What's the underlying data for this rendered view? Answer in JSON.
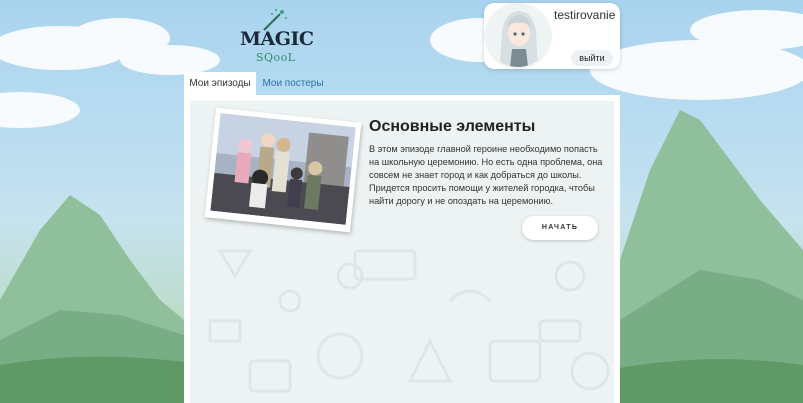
{
  "logo": {
    "line1": "MAGIC",
    "line2": "SQooL"
  },
  "profile": {
    "username": "testirovanie",
    "logout_label": "выйти"
  },
  "tabs": [
    {
      "label": "Мои эпизоды",
      "active": true
    },
    {
      "label": "Мои постеры",
      "active": false
    }
  ],
  "episode": {
    "title": "Основные элементы",
    "description": "В этом эпизоде главной героине необходимо попасть на школьную церемонию. Но есть одна проблема, она совсем не знает город и как добраться до школы. Придется просить помощи у жителей городка, чтобы найти дорогу и не опоздать на церемонию.",
    "start_label": "НАЧАТЬ"
  },
  "colors": {
    "accent_link": "#2d6fae",
    "panel_bg": "#edf3f3"
  }
}
